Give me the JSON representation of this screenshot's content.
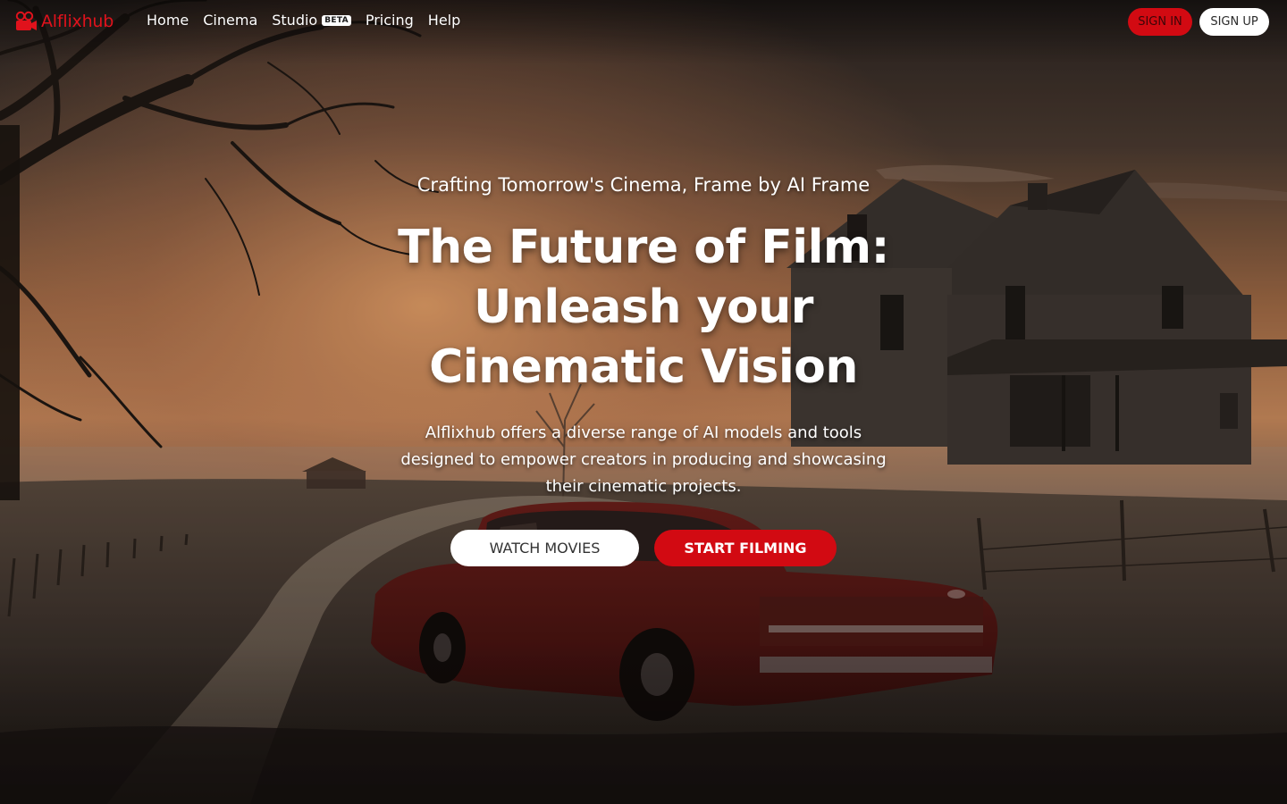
{
  "brand": {
    "name": "Alflixhub",
    "accent_color": "#d20a12",
    "logo_icon": "film-camera-icon"
  },
  "nav": {
    "links": [
      {
        "label": "Home"
      },
      {
        "label": "Cinema"
      },
      {
        "label": "Studio",
        "badge": "BETA"
      },
      {
        "label": "Pricing"
      },
      {
        "label": "Help"
      }
    ],
    "sign_in_label": "SIGN IN",
    "sign_up_label": "SIGN UP"
  },
  "hero": {
    "tagline": "Crafting Tomorrow's Cinema, Frame by AI Frame",
    "headline": "The Future of Film: Unleash your Cinematic Vision",
    "description": "Alflixhub offers a diverse range of AI models and tools designed to empower creators in producing and showcasing their cinematic projects.",
    "watch_label": "WATCH MOVIES",
    "film_label": "START FILMING"
  }
}
